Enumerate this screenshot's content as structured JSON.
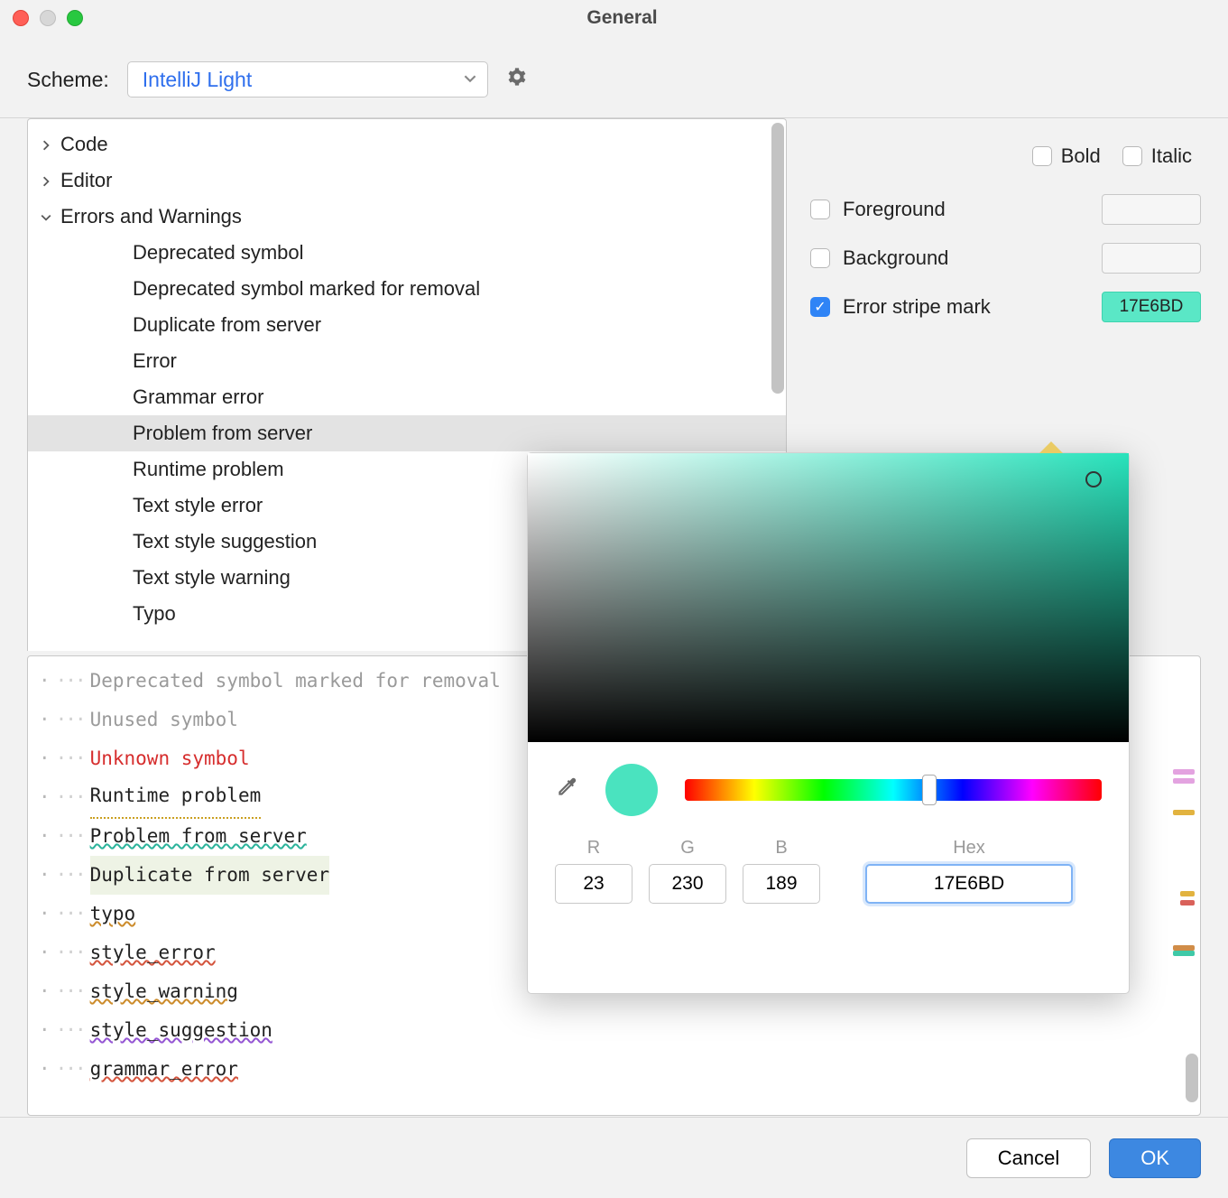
{
  "window": {
    "title": "General"
  },
  "scheme": {
    "label": "Scheme:",
    "value": "IntelliJ Light"
  },
  "tree": {
    "items": [
      {
        "label": "Code",
        "level": 0,
        "arrow": "right"
      },
      {
        "label": "Editor",
        "level": 0,
        "arrow": "right"
      },
      {
        "label": "Errors and Warnings",
        "level": 0,
        "arrow": "down"
      },
      {
        "label": "Deprecated symbol",
        "level": 1
      },
      {
        "label": "Deprecated symbol marked for removal",
        "level": 1
      },
      {
        "label": "Duplicate from server",
        "level": 1
      },
      {
        "label": "Error",
        "level": 1
      },
      {
        "label": "Grammar error",
        "level": 1
      },
      {
        "label": "Problem from server",
        "level": 1,
        "selected": true
      },
      {
        "label": "Runtime problem",
        "level": 1
      },
      {
        "label": "Text style error",
        "level": 1
      },
      {
        "label": "Text style suggestion",
        "level": 1
      },
      {
        "label": "Text style warning",
        "level": 1
      },
      {
        "label": "Typo",
        "level": 1
      }
    ]
  },
  "style_checks": {
    "bold": "Bold",
    "italic": "Italic"
  },
  "props": {
    "foreground": {
      "label": "Foreground",
      "checked": false
    },
    "background": {
      "label": "Background",
      "checked": false
    },
    "stripe": {
      "label": "Error stripe mark",
      "checked": true,
      "value": "17E6BD",
      "color": "#5AE7C6"
    }
  },
  "preview": {
    "lines": [
      {
        "text": "Deprecated symbol marked for removal",
        "style": "grey2"
      },
      {
        "text": "Unused symbol",
        "style": "grey"
      },
      {
        "text": "Unknown symbol",
        "style": "red"
      },
      {
        "text": "Runtime problem",
        "style": "warn-u"
      },
      {
        "text": "Problem from server",
        "style": "squig-teal"
      },
      {
        "text": "Duplicate from server",
        "style": "dup-bg"
      },
      {
        "text": "typo",
        "style": "squig-orange"
      },
      {
        "text": "style_error",
        "style": "squig-red"
      },
      {
        "text": "style_warning",
        "style": "squig-orange"
      },
      {
        "text": "style_suggestion",
        "style": "squig-purple"
      },
      {
        "text": "grammar_error",
        "style": "squig-red"
      }
    ]
  },
  "picker": {
    "r_label": "R",
    "g_label": "G",
    "b_label": "B",
    "hex_label": "Hex",
    "r": "23",
    "g": "230",
    "b": "189",
    "hex": "17E6BD"
  },
  "footer": {
    "cancel": "Cancel",
    "ok": "OK"
  }
}
